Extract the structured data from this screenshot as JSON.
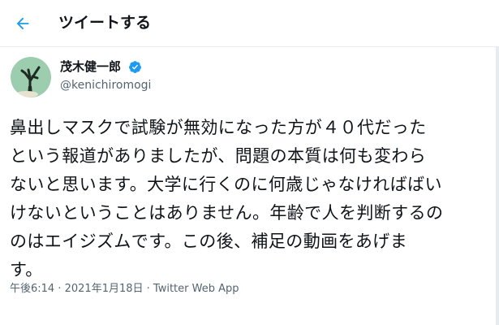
{
  "header": {
    "back_icon": "arrow-left-icon",
    "title": "ツイートする"
  },
  "author": {
    "display_name": "茂木健一郎",
    "handle": "@kenichiromogi",
    "verified_icon": "verified-badge-icon",
    "avatar_icon": "avatar-tree-illustration"
  },
  "tweet": {
    "lines": [
      "鼻出しマスクで試験が無効になった方が４０代だった",
      "という報道がありましたが、問題の本質は何も変わら",
      "ないと思います。大学に行くのに何歳じゃなければばい",
      "けないということはありません。年齢で人を判断するの",
      "のはエイジズムです。この後、補足の動画をあげま",
      "す。"
    ]
  },
  "meta": {
    "time": "午後6:14",
    "separator": " · ",
    "date": "2021年1月18日",
    "source": "Twitter Web App"
  },
  "colors": {
    "accent": "#1d9bf0",
    "text": "#0f1419",
    "secondary": "#536471",
    "border": "#e6ecf0"
  }
}
